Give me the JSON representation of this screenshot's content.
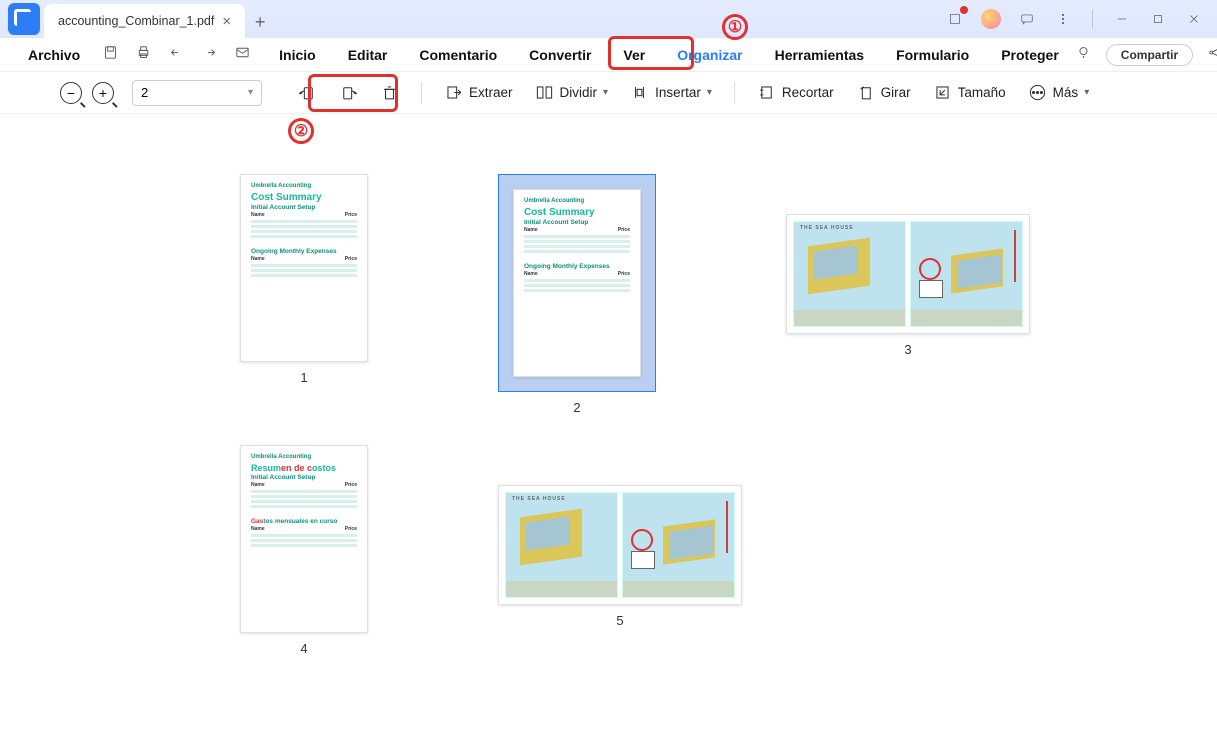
{
  "titlebar": {
    "tab_title": "accounting_Combinar_1.pdf",
    "close": "×",
    "newtab": "+"
  },
  "menubar": {
    "archivo": "Archivo",
    "inicio": "Inicio",
    "editar": "Editar",
    "comentario": "Comentario",
    "convertir": "Convertir",
    "ver": "Ver",
    "organizar": "Organizar",
    "herramientas": "Herramientas",
    "formulario": "Formulario",
    "proteger": "Proteger",
    "compartir": "Compartir"
  },
  "toolbar": {
    "page_value": "2",
    "extraer": "Extraer",
    "dividir": "Dividir",
    "insertar": "Insertar",
    "recortar": "Recortar",
    "girar": "Girar",
    "tamano": "Tamaño",
    "mas": "Más"
  },
  "callouts": {
    "one": "①",
    "two": "②"
  },
  "pages": {
    "p1": "1",
    "p2": "2",
    "p3": "3",
    "p4": "4",
    "p5": "5"
  },
  "doc_en": {
    "brand": "Umbrella Accounting",
    "title": "Cost Summary",
    "section1": "Initial Account Setup",
    "name": "Name",
    "price": "Price",
    "section2": "Ongoing Monthly Expenses"
  },
  "doc_es": {
    "title_a": "Resum",
    "title_b": "en de c",
    "title_c": "ostos",
    "section2_a": "Gas",
    "section2_b": "tos mensuales en curso"
  },
  "seahouse": {
    "title": "THE SEA HOUSE"
  }
}
